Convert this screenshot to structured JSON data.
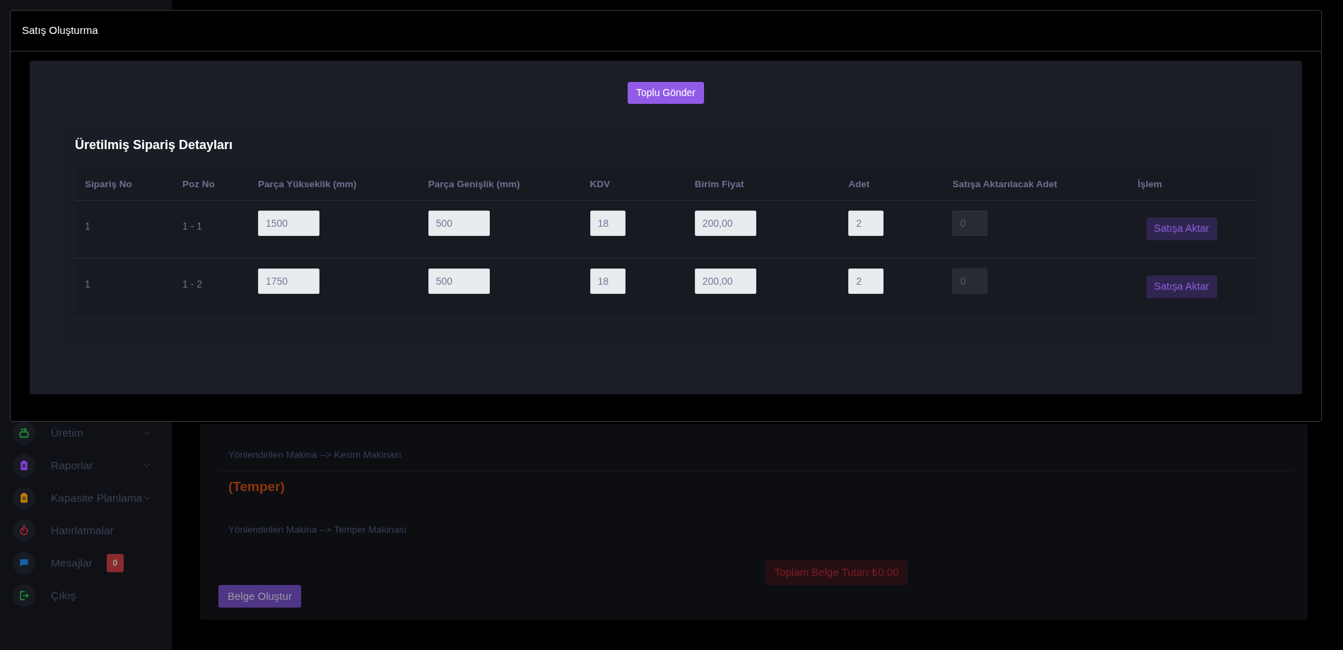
{
  "sidebar": {
    "items": [
      {
        "label": "Üretim",
        "color": "#1f9d3a",
        "expandable": true
      },
      {
        "label": "Raporlar",
        "color": "#7e3fd1",
        "expandable": true
      },
      {
        "label": "Kapasite Planlama",
        "color": "#c07d0a",
        "expandable": true
      },
      {
        "label": "Hatırlatmalar",
        "color": "#b3272d",
        "expandable": false
      },
      {
        "label": "Mesajlar",
        "color": "#1663a8",
        "expandable": false,
        "badge": "0"
      },
      {
        "label": "Çıkış",
        "color": "#1e8f36",
        "expandable": false
      }
    ]
  },
  "main": {
    "routes": [
      {
        "kind": "text",
        "text": "Yönlendirilen Makina --> Kesim Makinası"
      },
      {
        "kind": "heading",
        "text": "(Temper)"
      },
      {
        "kind": "text",
        "text": "Yönlendirilen Makina --> Temper Makinası"
      }
    ],
    "total": "Toplam Belge Tutarı ₺0,00",
    "create_button": "Belge Oluştur"
  },
  "modal": {
    "title": "Satış Oluşturma",
    "bulk_button": "Toplu Gönder",
    "card_title": "Üretilmiş Sipariş Detayları",
    "columns": [
      "Sipariş No",
      "Poz No",
      "Parça Yükseklik (mm)",
      "Parça Genişlik (mm)",
      "KDV",
      "Birim Fiyat",
      "Adet",
      "Satışa Aktarılacak Adet",
      "İşlem"
    ],
    "rows": [
      {
        "order_no": "1",
        "pos_no": "1 - 1",
        "inputs": [
          {
            "value": "1500",
            "disabled": false
          },
          {
            "value": "500",
            "disabled": false
          },
          {
            "value": "18",
            "disabled": false
          },
          {
            "value": "200,00",
            "disabled": false
          },
          {
            "value": "2",
            "disabled": false
          },
          {
            "value": "0",
            "disabled": true
          }
        ],
        "action": "Satışa Aktar"
      },
      {
        "order_no": "1",
        "pos_no": "1 - 2",
        "inputs": [
          {
            "value": "1750",
            "disabled": false
          },
          {
            "value": "500",
            "disabled": false
          },
          {
            "value": "18",
            "disabled": false
          },
          {
            "value": "200,00",
            "disabled": false
          },
          {
            "value": "2",
            "disabled": false
          },
          {
            "value": "0",
            "disabled": true
          }
        ],
        "action": "Satışa Aktar"
      }
    ]
  }
}
